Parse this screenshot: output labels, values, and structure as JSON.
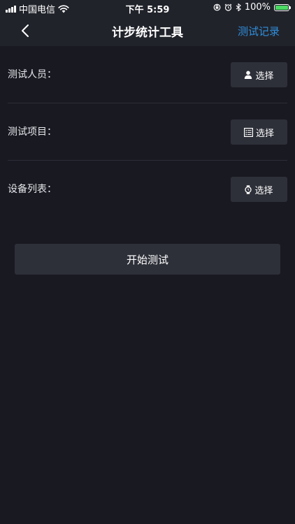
{
  "status_bar": {
    "carrier": "中国电信",
    "time": "下午 5:59",
    "battery_percent": "100%",
    "battery_level": 1.0,
    "battery_color": "#4cd964"
  },
  "nav": {
    "back_icon": "chevron-left-icon",
    "title": "计步统计工具",
    "right_action": "测试记录",
    "right_action_color": "#2f8fdc"
  },
  "form": {
    "rows": [
      {
        "label": "测试人员：",
        "button_label": "选择",
        "icon": "person-icon"
      },
      {
        "label": "测试项目：",
        "button_label": "选择",
        "icon": "list-icon"
      },
      {
        "label": "设备列表：",
        "button_label": "选择",
        "icon": "watch-icon"
      }
    ]
  },
  "start_button": {
    "label": "开始测试"
  }
}
